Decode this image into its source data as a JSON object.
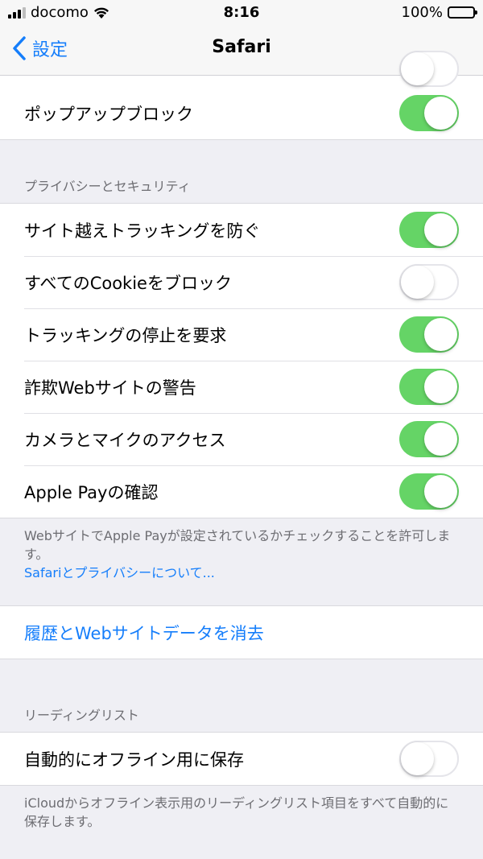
{
  "status_bar": {
    "carrier": "docomo",
    "time": "8:16",
    "battery": "100%"
  },
  "nav": {
    "back_label": "設定",
    "title": "Safari"
  },
  "general": [
    {
      "label": "ポップアップブロック",
      "on": true
    }
  ],
  "privacy": {
    "header": "プライバシーとセキュリティ",
    "items": [
      {
        "label": "サイト越えトラッキングを防ぐ",
        "on": true
      },
      {
        "label": "すべてのCookieをブロック",
        "on": false
      },
      {
        "label": "トラッキングの停止を要求",
        "on": true
      },
      {
        "label": "詐欺Webサイトの警告",
        "on": true
      },
      {
        "label": "カメラとマイクのアクセス",
        "on": true
      },
      {
        "label": "Apple Payの確認",
        "on": true
      }
    ],
    "footer": "WebサイトでApple Payが設定されているかチェックすることを許可します。",
    "footer_link": "Safariとプライバシーについて..."
  },
  "clear": {
    "label": "履歴とWebサイトデータを消去"
  },
  "reading_list": {
    "header": "リーディングリスト",
    "items": [
      {
        "label": "自動的にオフライン用に保存",
        "on": false
      }
    ],
    "footer": "iCloudからオフライン表示用のリーディングリスト項目をすべて自動的に保存します。"
  },
  "colors": {
    "accent": "#157efb",
    "toggle_on": "#65d466",
    "background": "#efeff4"
  }
}
